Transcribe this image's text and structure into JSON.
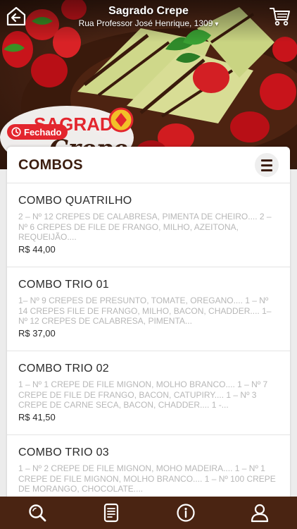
{
  "header": {
    "title": "Sagrado Crepe",
    "address": "Rua Professor José Henrique, 1309",
    "back_icon": "back-arrow-icon",
    "cart_icon": "cart-icon"
  },
  "hero": {
    "logo_text": "SAGRADO",
    "logo_script": "Crepe",
    "status_label": "Fechado",
    "status_icon": "clock-icon",
    "status_color": "#e3262e"
  },
  "menu": {
    "section_title": "COMBOS",
    "menu_icon": "list-icon",
    "items": [
      {
        "name": "COMBO QUATRILHO",
        "description": "2 – nº 12 CREPES DE CALABRESA, PIMENTA DE CHEIRO.... 2 – nº 6 CREPES DE FILE DE FRANGO, MILHO, AZEITONA, REQUEIJÃO....",
        "price": "R$ 44,00"
      },
      {
        "name": "COMBO TRIO 01",
        "description": "1– nº 9 CREPES DE PRESUNTO, TOMATE, OREGANO.... 1 – nº 14 CREPES FILE DE FRANGO, MILHO, BACON, CHADDER.... 1– nº 12 CREPES DE CALABRESA, PIMENTA...",
        "price": "R$ 37,00"
      },
      {
        "name": "COMBO TRIO 02",
        "description": "1 – nº 1 CREPE DE FILE MIGNON, MOLHO BRANCO.... 1 – nº 7 CREPE DE FILE DE FRANGO, BACON, CATUPIRY.... 1 – nº 3 CREPE DE CARNE SECA, BACON, CHADDER.... 1 -...",
        "price": "R$ 41,50"
      },
      {
        "name": "COMBO TRIO 03",
        "description": "1 – nº 2 CREPE DE FILE MIGNON, MOHO MADEIRA.... 1 – nº 1 CREPE DE FILE MIGNON, MOLHO BRANCO.... 1 – nº 100 CREPE DE MORANGO, CHOCOLATE....",
        "price": ""
      }
    ]
  },
  "bottom_nav": {
    "color": "#4a2412",
    "items": [
      {
        "icon": "search-icon"
      },
      {
        "icon": "receipt-icon"
      },
      {
        "icon": "info-icon"
      },
      {
        "icon": "user-icon"
      }
    ]
  }
}
